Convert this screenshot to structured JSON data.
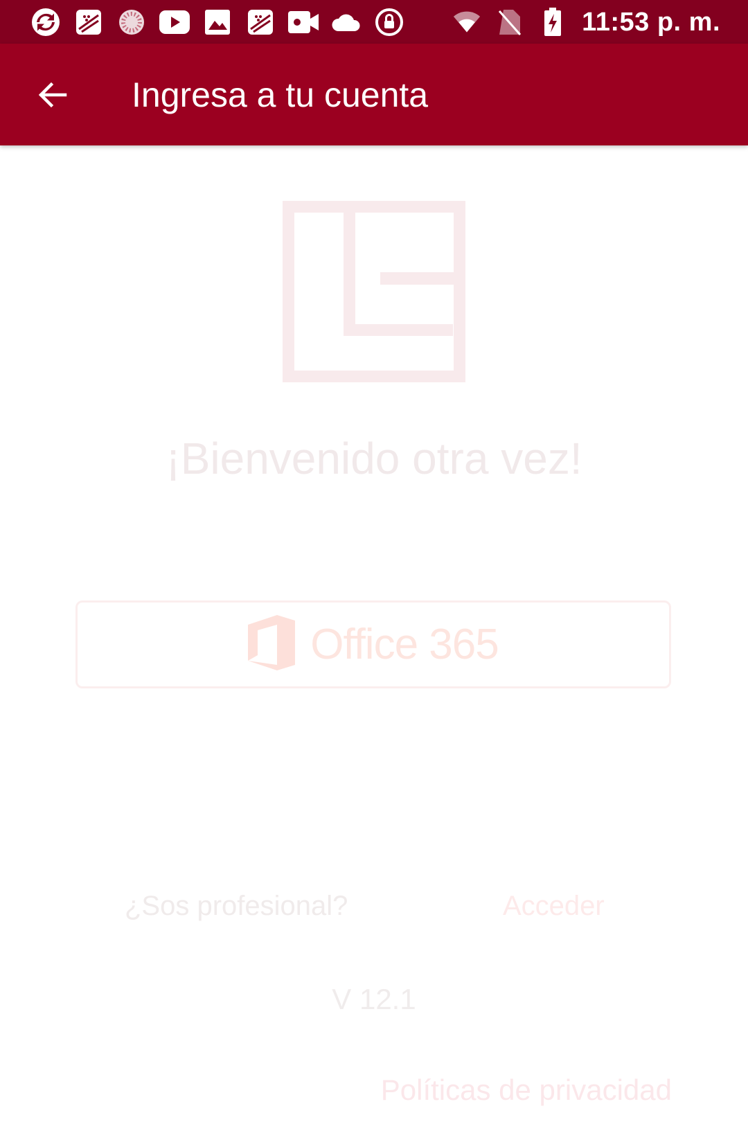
{
  "status_bar": {
    "time": "11:53 p. m.",
    "left_icons": [
      "sync-app-icon",
      "blackberry-app-icon",
      "loading-app-icon",
      "youtube-icon",
      "gallery-icon",
      "blackberry-app-icon",
      "video-camera-icon",
      "cloud-icon",
      "lock-circle-icon"
    ],
    "right_icons": [
      "wifi-icon",
      "no-sim-icon",
      "battery-charging-icon"
    ]
  },
  "app_bar": {
    "title": "Ingresa a tu cuenta",
    "back_icon": "arrow-back-icon"
  },
  "main": {
    "welcome": "¡Bienvenido otra vez!",
    "office_button_label": "Office 365",
    "pro_question": "¿Sos profesional?",
    "pro_link": "Acceder",
    "version": "V 12.1",
    "privacy_link": "Políticas de privacidad"
  },
  "colors": {
    "status_bar": "#83001f",
    "app_bar": "#9b0020",
    "background": "#ffffff",
    "logo_tint": "#f8eaec"
  }
}
